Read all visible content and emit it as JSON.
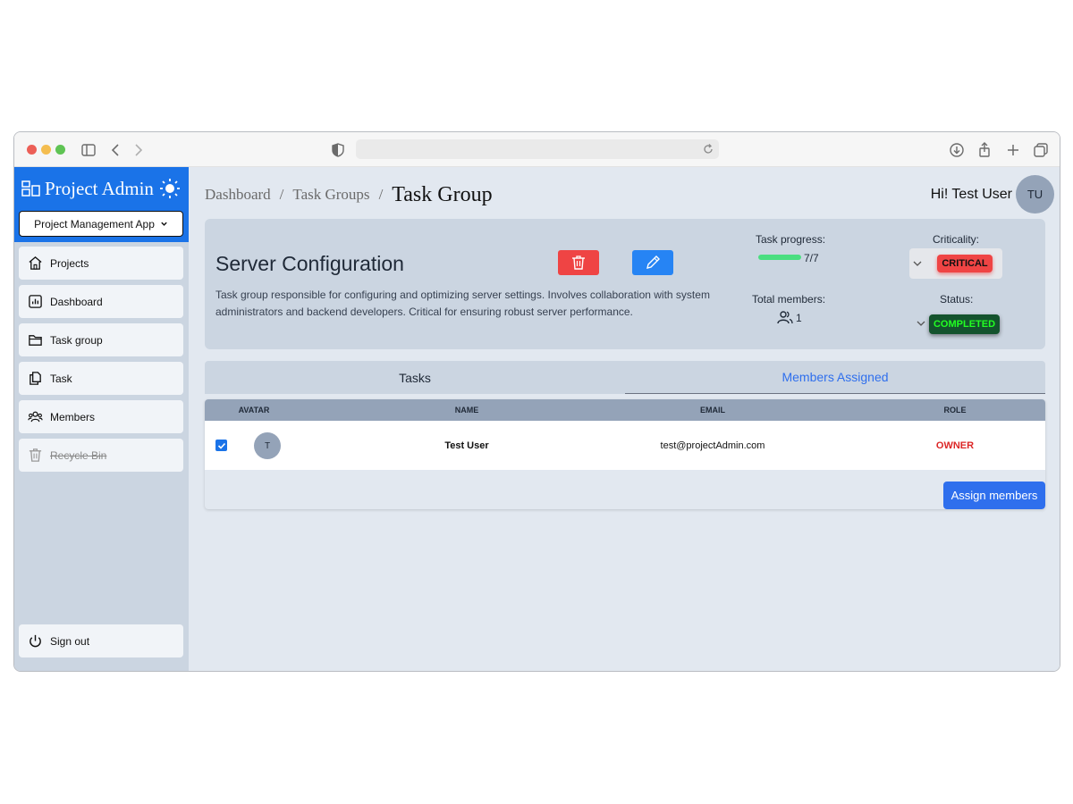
{
  "browser": {
    "traffic_colors": [
      "#ec5f57",
      "#f4bd4f",
      "#5fc454"
    ]
  },
  "sidebar": {
    "brand_title": "Project Admin",
    "app_select": "Project Management App",
    "items": [
      {
        "label": "Projects",
        "icon": "home-icon"
      },
      {
        "label": "Dashboard",
        "icon": "chart-icon"
      },
      {
        "label": "Task group",
        "icon": "folder-icon"
      },
      {
        "label": "Task",
        "icon": "files-icon"
      },
      {
        "label": "Members",
        "icon": "users-icon"
      },
      {
        "label": "Recycle Bin",
        "icon": "trash-icon",
        "disabled": true
      }
    ],
    "signout_label": "Sign out"
  },
  "header": {
    "breadcrumbs": [
      "Dashboard",
      "Task Groups"
    ],
    "separator": "/",
    "current": "Task Group",
    "greeting": "Hi! Test User",
    "avatar_initials": "TU"
  },
  "task_group": {
    "title": "Server Configuration",
    "description": "Task group responsible for configuring and optimizing server settings. Involves collaboration with system administrators and backend developers. Critical for ensuring robust server performance.",
    "progress_label": "Task progress:",
    "progress_text": "7/7",
    "progress_fraction": 1.0,
    "members_label": "Total members:",
    "members_count": "1",
    "criticality_label": "Criticality:",
    "criticality_value": "CRITICAL",
    "status_label": "Status:",
    "status_value": "COMPLETED"
  },
  "tabs": [
    {
      "label": "Tasks",
      "active": false
    },
    {
      "label": "Members Assigned",
      "active": true
    }
  ],
  "members_table": {
    "headers": [
      "AVATAR",
      "NAME",
      "EMAIL",
      "ROLE"
    ],
    "rows": [
      {
        "checked": true,
        "avatar": "T",
        "name": "Test User",
        "email": "test@projectAdmin.com",
        "role": "OWNER"
      }
    ],
    "assign_button": "Assign members"
  },
  "colors": {
    "brand": "#1a73e8",
    "critical": "#ef4444",
    "completed": "#15803d",
    "owner": "#dc2626",
    "accent": "#2f6fed"
  }
}
